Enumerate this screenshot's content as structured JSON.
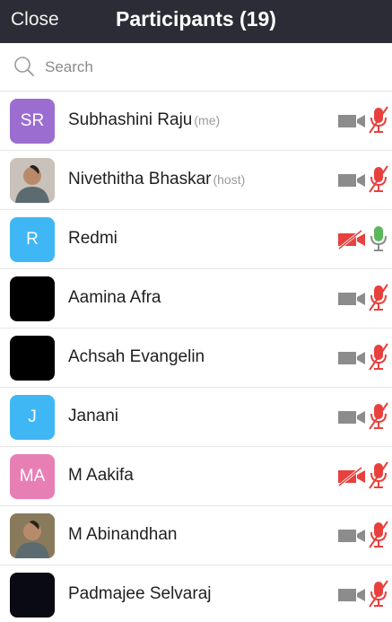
{
  "header": {
    "close_label": "Close",
    "title": "Participants (19)"
  },
  "search": {
    "placeholder": "Search",
    "icon": "search-icon"
  },
  "colors": {
    "header_bg": "#2c2c36",
    "muted_red": "#e8413d",
    "cam_gray": "#8c8c8c",
    "mic_green": "#5cb85c"
  },
  "participants": [
    {
      "name": "Subhashini Raju",
      "tag": "(me)",
      "initials": "SR",
      "avatar_color": "#9b6dd1",
      "avatar_type": "initials",
      "video": "on",
      "audio": "muted"
    },
    {
      "name": "Nivethitha Bhaskar",
      "tag": "(host)",
      "initials": "",
      "avatar_color": "#c9c2bb",
      "avatar_type": "photo",
      "video": "on",
      "audio": "muted"
    },
    {
      "name": "Redmi",
      "tag": "",
      "initials": "R",
      "avatar_color": "#3fb7f5",
      "avatar_type": "initials",
      "video": "off",
      "audio": "unmuted"
    },
    {
      "name": "Aamina Afra",
      "tag": "",
      "initials": "",
      "avatar_color": "#000000",
      "avatar_type": "blank",
      "video": "on",
      "audio": "muted"
    },
    {
      "name": "Achsah Evangelin",
      "tag": "",
      "initials": "",
      "avatar_color": "#000000",
      "avatar_type": "blank",
      "video": "on",
      "audio": "muted"
    },
    {
      "name": "Janani",
      "tag": "",
      "initials": "J",
      "avatar_color": "#3fb7f5",
      "avatar_type": "initials",
      "video": "on",
      "audio": "muted"
    },
    {
      "name": "M Aakifa",
      "tag": "",
      "initials": "MA",
      "avatar_color": "#e87fb4",
      "avatar_type": "initials",
      "video": "off",
      "audio": "muted"
    },
    {
      "name": "M Abinandhan",
      "tag": "",
      "initials": "",
      "avatar_color": "#8a7a5c",
      "avatar_type": "photo",
      "video": "on",
      "audio": "muted"
    },
    {
      "name": "Padmajee Selvaraj",
      "tag": "",
      "initials": "",
      "avatar_color": "#0a0a12",
      "avatar_type": "blank",
      "video": "on",
      "audio": "muted"
    }
  ]
}
